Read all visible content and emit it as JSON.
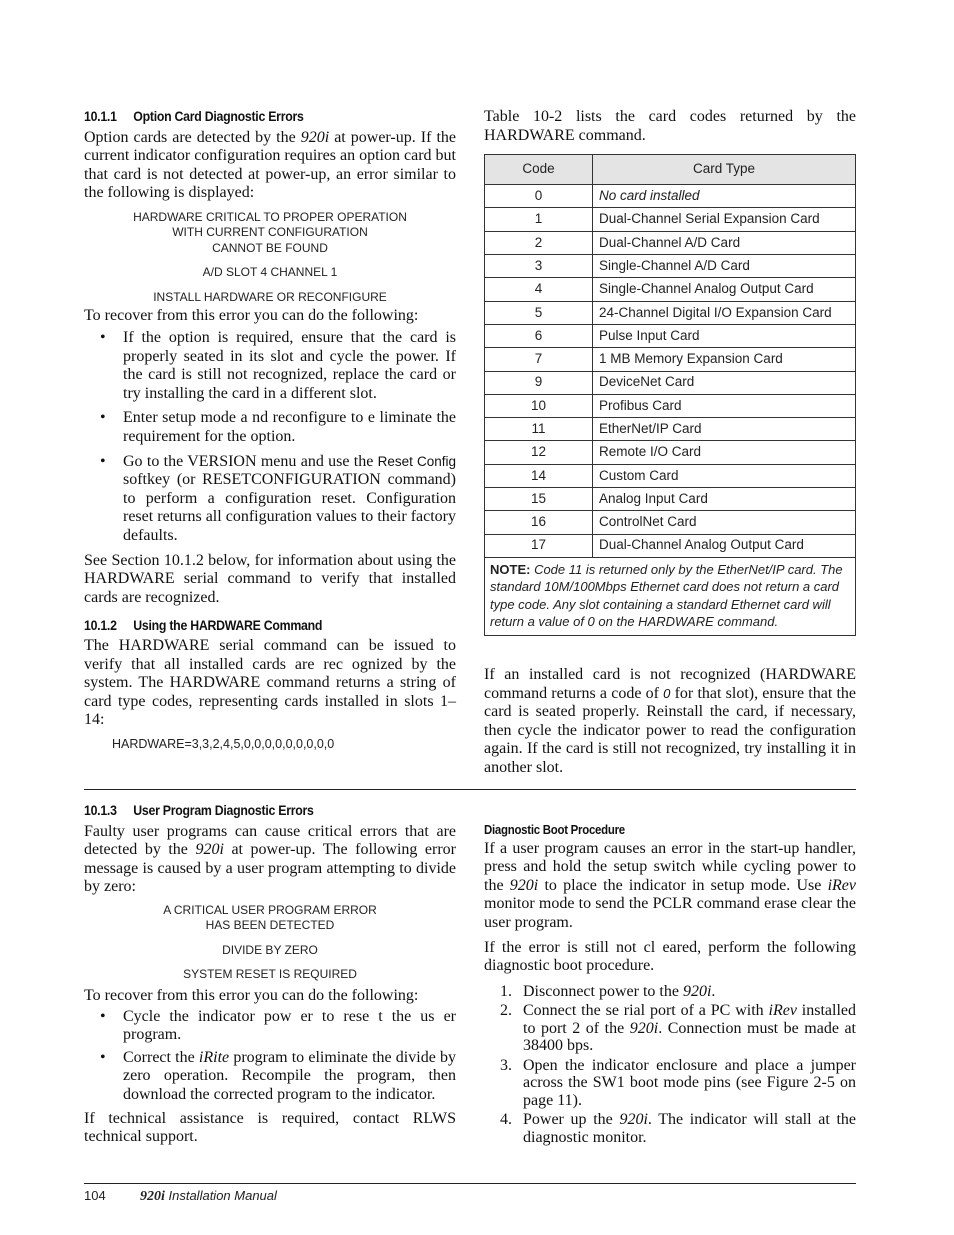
{
  "sections": {
    "s1011": {
      "number": "10.1.1",
      "title": "Option Card Diagnostic Errors",
      "intro_a": "Option cards are detected by the ",
      "intro_product": "920i",
      "intro_b": " at power-up. If the current indicator configuration requires an option card but that card is not detected at power-up, an error similar to the following is displayed:",
      "display_lines": [
        "HARDWARE CRITICAL TO PROPER OPERATION",
        "WITH CURRENT CONFIGURATION",
        "CANNOT BE FOUND",
        "A/D SLOT 4 CHANNEL 1",
        "INSTALL HARDWARE OR RECONFIGURE"
      ],
      "recover_intro": "To recover from this error you can do the following:",
      "bullets": [
        "If the option is required,  ensure that the card is properly seated in its slot and cycle the power. If the card is still not recognized, replace the card or try installing the card in a different slot.",
        "Enter setup mode a nd reconfigure to e liminate the requirement for the option."
      ],
      "bullet3_a": "Go to the VERSION  menu and use the ",
      "bullet3_softkey": "Reset Config",
      "bullet3_b": " softkey (or RESETCONFIGURATION command) to perform a configuration reset. Configuration reset returns all configuration values to their factory defaults.",
      "see_section": "See Section 10.1.2 below, for information about using the HARDWARE serial command to verify that installed cards are recognized."
    },
    "s1012": {
      "number": "10.1.2",
      "title": "Using the HARDWARE Command",
      "body": "The HARDWARE serial command can be issued to verify that all installed cards are rec ognized by the system. The HARDWARE command returns a string of card type codes, representing cards installed in slots 1–14:",
      "example": "HARDWARE=3,3,2,4,5,0,0,0,0,0,0,0,0,0"
    },
    "table_intro": "Table 10-2 lists the card codes returned by the HARDWARE command.",
    "table": {
      "headers": [
        "Code",
        "Card Type"
      ],
      "rows": [
        {
          "code": "0",
          "type": "No card installed"
        },
        {
          "code": "1",
          "type": "Dual-Channel Serial Expansion Card"
        },
        {
          "code": "2",
          "type": "Dual-Channel A/D Card"
        },
        {
          "code": "3",
          "type": "Single-Channel A/D Card"
        },
        {
          "code": "4",
          "type": "Single-Channel Analog Output Card"
        },
        {
          "code": "5",
          "type": "24-Channel Digital I/O Expansion Card"
        },
        {
          "code": "6",
          "type": "Pulse Input Card"
        },
        {
          "code": "7",
          "type": "1 MB Memory Expansion Card"
        },
        {
          "code": "9",
          "type": "DeviceNet Card"
        },
        {
          "code": "10",
          "type": "Profibus Card"
        },
        {
          "code": "11",
          "type": "EtherNet/IP Card"
        },
        {
          "code": "12",
          "type": "Remote I/O Card"
        },
        {
          "code": "14",
          "type": "Custom Card"
        },
        {
          "code": "15",
          "type": "Analog Input Card"
        },
        {
          "code": "16",
          "type": "ControlNet Card"
        },
        {
          "code": "17",
          "type": "Dual-Channel Analog Output Card"
        }
      ],
      "note_label": "NOTE:",
      "note_text": " Code 11 is returned only by the EtherNet/IP card. The standard 10M/100Mbps Ethernet card does not return a card type code. Any slot containing a standard Ethernet card will return a value of 0 on the HARDWARE command."
    },
    "not_recognized_a": "If an installed card is not recognized (HARDWARE command returns a code of ",
    "not_recognized_code": "0",
    "not_recognized_b": " for that slot), ensure that the card is seated properly. Reinstall the card, if necessary, then cycle the indicator power to read the configuration again. If the card is still not recognized, try installing it in another slot.",
    "s1013": {
      "number": "10.1.3",
      "title": "User Program Diagnostic Errors",
      "intro_a": "Faulty user programs can cause critical errors that are detected by the ",
      "intro_product": "920i",
      "intro_b": " at power-up. The following error message is caused by a user program attempting to divide by zero:",
      "display_lines": [
        "A CRITICAL USER PROGRAM ERROR",
        "HAS BEEN DETECTED",
        "DIVIDE BY ZERO",
        "SYSTEM RESET IS REQUIRED"
      ],
      "recover_intro": "To recover from this error you can do the following:",
      "bullet1": "Cycle the indicator pow   er to rese  t the  us er program.",
      "bullet2_a": "Correct the ",
      "bullet2_irite": "iRite",
      "bullet2_b": " program to eliminate the divide by zero operation. Recompile the program, then download the corrected program to the indicator.",
      "assist": "If technical assistance is required, contact RLWS technical support."
    },
    "boot": {
      "title": "Diagnostic Boot Procedure",
      "p1_a": "If a user program causes an error in the start-up handler, press and hold the setup switch while cycling power to the ",
      "p1_product": "920i",
      "p1_b": " to place the indicator in setup mode. Use ",
      "p1_irev": "iRev",
      "p1_c": " monitor mode to send the PCLR command erase clear the user program.",
      "p2": "If the error is still not cl eared, perform the following diagnostic boot procedure.",
      "steps": {
        "s1_a": "Disconnect power to the ",
        "s1_product": "920i",
        "s1_b": ".",
        "s2_a": "Connect the se  rial port of a   PC with   ",
        "s2_irev": "iRev",
        "s2_b": " installed to port 2 of the ",
        "s2_product": "920i",
        "s2_c": ". Connection must be made at 38400 bps.",
        "s3": "Open the indicator enclosure and place a jumper across the SW1 boot mode pins (see Figure 2-5 on page 11).",
        "s4_a": "Power up the ",
        "s4_product": "920i",
        "s4_b": ". The indicator will stall at the diagnostic monitor."
      },
      "step_numbers": [
        "1.",
        "2.",
        "3.",
        "4."
      ]
    }
  },
  "bullet_glyph": "•",
  "footer": {
    "page_number": "104",
    "product": "920i",
    "manual_title": " Installation Manual"
  }
}
